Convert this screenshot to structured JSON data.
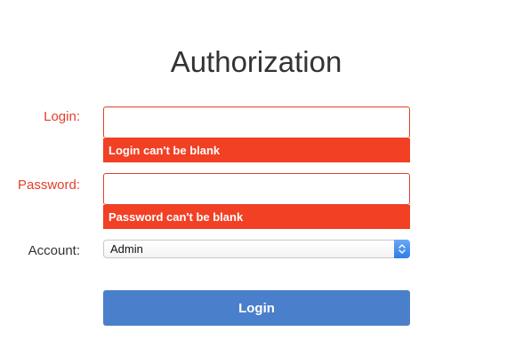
{
  "form": {
    "title": "Authorization",
    "login": {
      "label": "Login:",
      "value": "",
      "placeholder": "",
      "error": "Login can't be blank"
    },
    "password": {
      "label": "Password:",
      "value": "",
      "placeholder": "",
      "error": "Password can't be blank"
    },
    "account": {
      "label": "Account:",
      "selected": "Admin"
    },
    "submit_label": "Login"
  },
  "colors": {
    "error": "#f24024",
    "error_text": "#e2402a",
    "primary_button": "#4a7fcb",
    "select_arrow": "#2f7de8"
  }
}
